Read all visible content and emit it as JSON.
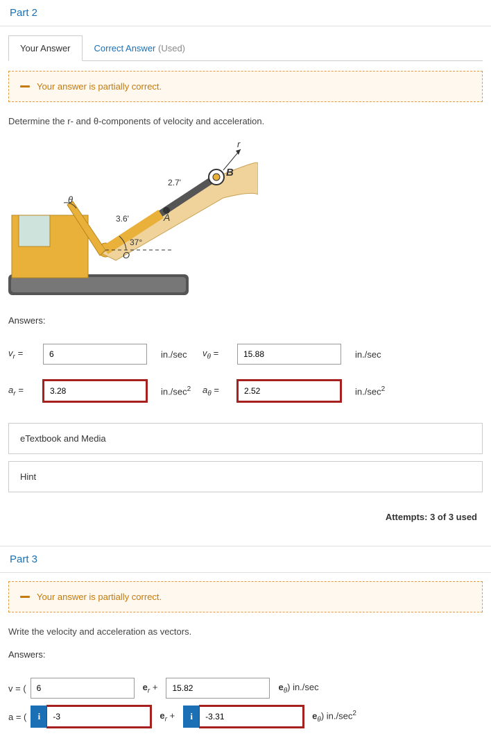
{
  "part2": {
    "header": "Part 2",
    "tabs": {
      "your_answer": "Your Answer",
      "correct_answer_blue": "Correct Answer",
      "correct_answer_gray": " (Used)"
    },
    "alert": "Your answer is partially correct.",
    "prompt": "Determine the r- and θ-components of velocity and acceleration.",
    "figure": {
      "dim1": "2.7'",
      "dim2": "3.6'",
      "angle": "37°",
      "ptA": "A",
      "ptB": "B",
      "ptO": "O",
      "axis_r": "r",
      "theta": "θ"
    },
    "answers_label": "Answers:",
    "rows": {
      "vr_label": "v",
      "vr_sub": "r",
      "vr_eq": " = ",
      "vr_value": "6",
      "vr_unit": "in./sec",
      "vt_label": "v",
      "vt_sub": "θ",
      "vt_eq": " = ",
      "vt_value": "15.88",
      "vt_unit": "in./sec",
      "ar_label": "a",
      "ar_sub": "r",
      "ar_eq": " = ",
      "ar_value": "3.28",
      "ar_unit_base": "in./sec",
      "ar_unit_sup": "2",
      "at_label": "a",
      "at_sub": "θ",
      "at_eq": " = ",
      "at_value": "2.52",
      "at_unit_base": "in./sec",
      "at_unit_sup": "2"
    },
    "etextbook": "eTextbook and Media",
    "hint": "Hint",
    "attempts": "Attempts: 3 of 3 used"
  },
  "part3": {
    "header": "Part 3",
    "alert": "Your answer is partially correct.",
    "prompt": "Write the velocity and acceleration as vectors.",
    "answers_label": "Answers:",
    "v": {
      "prefix": "v = (",
      "val1": "6",
      "mid": "e",
      "mid_sub": "r",
      "plus": " + ",
      "val2": "15.82",
      "suffix_pre": "e",
      "suffix_sub": "θ",
      "suffix_unit": ") in./sec"
    },
    "a": {
      "prefix": "a = (",
      "info": "i",
      "val1": "-3",
      "mid": "e",
      "mid_sub": "r",
      "plus": " + ",
      "info2": "i",
      "val2": "-3.31",
      "suffix_pre": "e",
      "suffix_sub": "θ",
      "suffix_unit_base": ") in./sec",
      "suffix_unit_sup": "2"
    }
  }
}
